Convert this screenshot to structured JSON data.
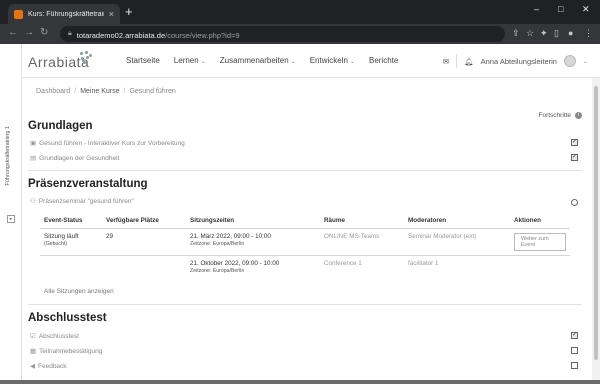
{
  "browser": {
    "tab_title": "Kurs: Führungskräftetraining 1",
    "tab_close": "×",
    "new_tab": "+",
    "url_host": "totarademo02.arrabiata.de",
    "url_path": "/course/view.php?id=9",
    "win_min": "–",
    "win_max": "□",
    "win_close": "✕"
  },
  "drawer": {
    "course_label": "Führungskräftetraining 1",
    "toggle": "▸"
  },
  "header": {
    "logo_text": "Arrabiata",
    "menu": [
      {
        "label": "Startseite",
        "has_menu": false
      },
      {
        "label": "Lernen",
        "has_menu": true
      },
      {
        "label": "Zusammenarbeiten",
        "has_menu": true
      },
      {
        "label": "Entwickeln",
        "has_menu": true
      },
      {
        "label": "Berichte",
        "has_menu": false
      }
    ],
    "user_name": "Anna Abteilungsleiterin"
  },
  "breadcrumb": [
    "Dashboard",
    "Meine Kurse",
    "Gesund führen"
  ],
  "progress_label": "Fortschritte",
  "sections": {
    "grundlagen": {
      "title": "Grundlagen",
      "activities": [
        {
          "label": "Gesund führen - Interaktiver Kurs zur Vorbereitung",
          "icon": "package-icon",
          "completed": true
        },
        {
          "label": "Grundlagen der Gesundheit",
          "icon": "document-icon",
          "completed": true
        }
      ]
    },
    "praesenz": {
      "title": "Präsenzveranstaltung",
      "seminar_label": "Präsenzseminar \"gesund führen\"",
      "table_headers": [
        "Event-Status",
        "Verfügbare Plätze",
        "Sitzungszeiten",
        "Räume",
        "Moderatoren",
        "Aktionen"
      ],
      "sessions": [
        {
          "status": "Sitzung läuft",
          "status_sub": "(Gebucht)",
          "places": "29",
          "time": "21. März 2022, 09:00 - 10:00",
          "timezone": "Zeitzone: Europa/Berlin",
          "room": "ONLINE MS-Teams",
          "moderator": "Seminar Moderator (ext)",
          "action": "Weiter zum Event"
        },
        {
          "time": "21. Oktober 2022, 09:00 - 10:00",
          "timezone": "Zeitzone: Europa/Berlin",
          "room": "Conference 1",
          "moderator": "facilitator 1"
        }
      ],
      "show_all": "Alle Sitzungen anzeigen"
    },
    "abschluss": {
      "title": "Abschlusstest",
      "activities": [
        {
          "label": "Abschlusstest",
          "icon": "quiz-icon",
          "completed": true
        },
        {
          "label": "Teilnahmebestätigung",
          "icon": "certificate-icon",
          "completed": false
        },
        {
          "label": "Feedback",
          "icon": "megaphone-icon",
          "completed": false
        }
      ]
    }
  },
  "colors": {
    "chrome_dark": "#202124",
    "chrome_tab": "#35363a",
    "favicon": "#e8730c",
    "text": "#333333",
    "muted": "#888888"
  }
}
